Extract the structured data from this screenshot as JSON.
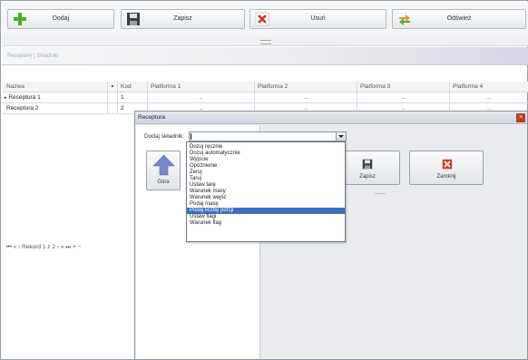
{
  "toolbar": {
    "add_label": "Dodaj",
    "save_label": "Zapisz",
    "delete_label": "Usuń",
    "refresh_label": "Odśwież"
  },
  "group_header": "Receptury | Składniki",
  "grid": {
    "columns": [
      "Nazwa",
      "Kod",
      "Platforma 1",
      "Platforma 2",
      "Platforma 3",
      "Platforma 4"
    ],
    "rows": [
      {
        "name": "Receptura 1",
        "code": "1",
        "p1": "...",
        "p2": "...",
        "p3": "...",
        "p4": "..."
      },
      {
        "name": "Receptura 2",
        "code": "2",
        "p1": "...",
        "p2": "...",
        "p3": "...",
        "p4": "..."
      }
    ]
  },
  "navigator": {
    "record_text": "Rekord 1 z 2"
  },
  "dialog": {
    "title": "Receptura",
    "add_ingredient_label": "Dodaj składnik:",
    "combo_value": "",
    "up_button_label": "Góra",
    "save_button_label": "Zapisz",
    "close_button_label": "Zamknij",
    "dropdown_selected_index": 13,
    "dropdown_options": [
      "Dozuj ręcznie",
      "Dozuj automatycznie",
      "Wyjście",
      "Opóźnienie",
      "Zeruj",
      "Taruj",
      "Ustaw tarę",
      "Warunek masy",
      "Warunek wejść",
      "Podaj masę",
      "Podaj liczbę porcji",
      "Ustaw flagi",
      "Warunek flag"
    ]
  },
  "colors": {
    "selection": "#3e6ec0",
    "close_red": "#d13a2a",
    "add_green": "#4caf2a",
    "up_arrow": "#7a88c8"
  }
}
